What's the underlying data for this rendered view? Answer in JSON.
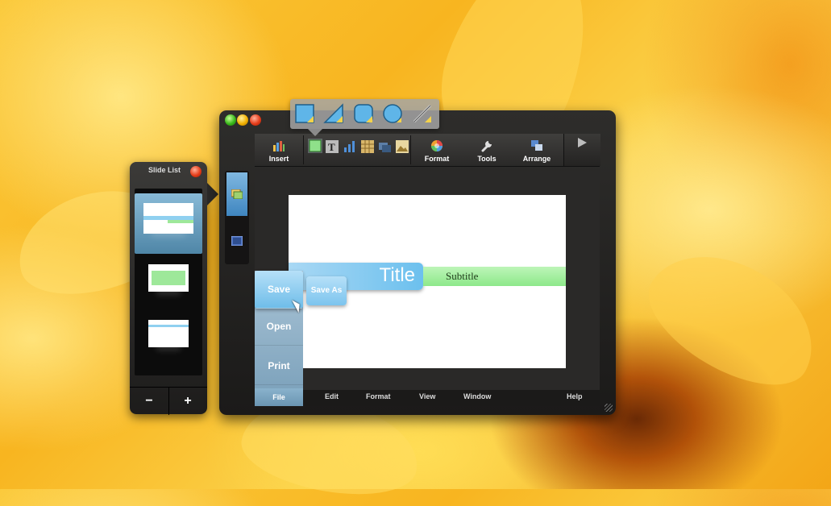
{
  "slide_panel": {
    "title": "Slide List",
    "minus_label": "−",
    "plus_label": "+"
  },
  "toolbar": {
    "insert_label": "Insert",
    "format_label": "Format",
    "tools_label": "Tools",
    "arrange_label": "Arrange"
  },
  "slide": {
    "title": "Title",
    "subtitle": "Subtitle"
  },
  "file_menu": {
    "save": "Save",
    "save_as": "Save As",
    "open": "Open",
    "print": "Print"
  },
  "menubar": {
    "file": "File",
    "edit": "Edit",
    "format": "Format",
    "view": "View",
    "window": "Window",
    "help": "Help"
  },
  "colors": {
    "accent_blue": "#6fbde9",
    "subtitle_green": "#8de88a",
    "window_dark": "#1b1a19"
  }
}
